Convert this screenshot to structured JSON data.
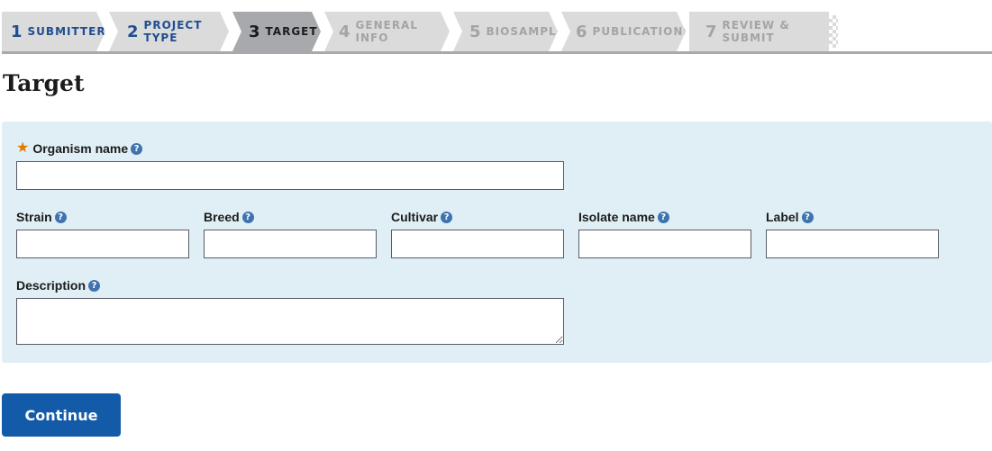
{
  "steps": [
    {
      "num": "1",
      "label": "Submitter",
      "state": "done"
    },
    {
      "num": "2",
      "label": "Project Type",
      "state": "done"
    },
    {
      "num": "3",
      "label": "Target",
      "state": "current"
    },
    {
      "num": "4",
      "label": "General Info",
      "state": "todo"
    },
    {
      "num": "5",
      "label": "Biosample",
      "state": "todo"
    },
    {
      "num": "6",
      "label": "Publications",
      "state": "todo"
    },
    {
      "num": "7",
      "label": "Review & Submit",
      "state": "todo"
    }
  ],
  "page": {
    "title": "Target"
  },
  "form": {
    "organism_name": {
      "label": "Organism name",
      "value": "",
      "required": true
    },
    "strain": {
      "label": "Strain",
      "value": ""
    },
    "breed": {
      "label": "Breed",
      "value": ""
    },
    "cultivar": {
      "label": "Cultivar",
      "value": ""
    },
    "isolate_name": {
      "label": "Isolate name",
      "value": ""
    },
    "label_field": {
      "label": "Label",
      "value": ""
    },
    "description": {
      "label": "Description",
      "value": ""
    },
    "help_glyph": "?",
    "required_glyph": "★"
  },
  "actions": {
    "continue_label": "Continue"
  },
  "colors": {
    "accent": "#135ba8",
    "panel": "#dfeff5",
    "required": "#e07a00",
    "done_step": "#1f4d91"
  }
}
